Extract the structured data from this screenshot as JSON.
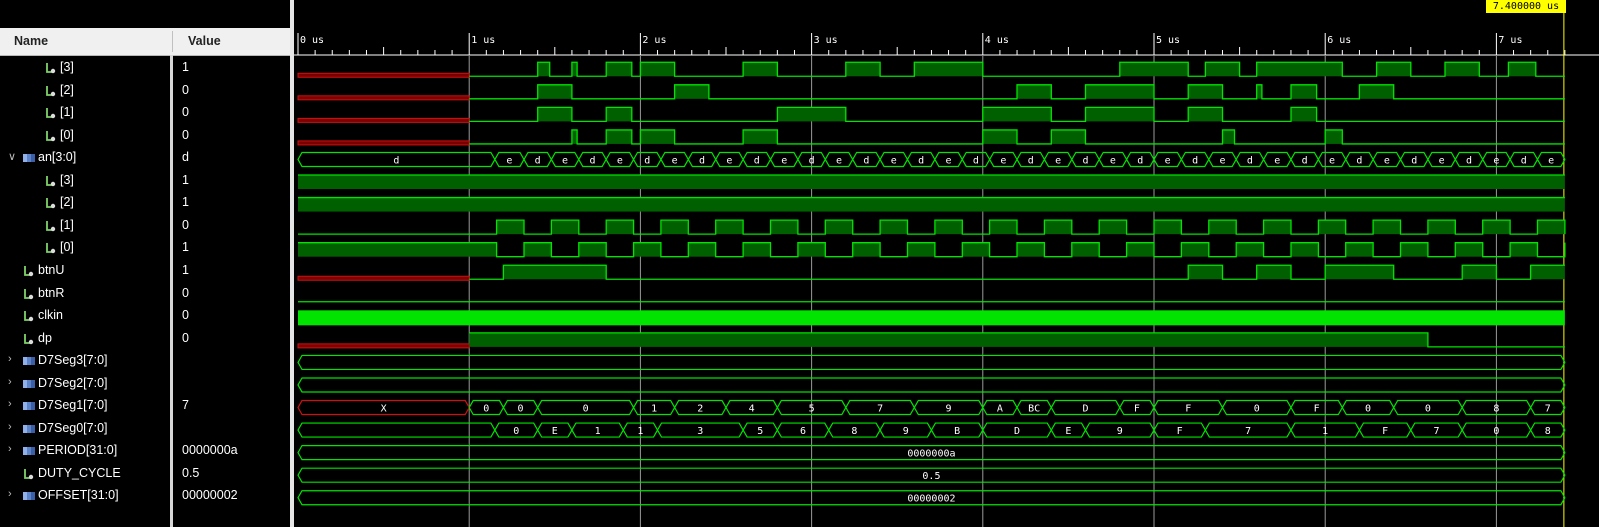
{
  "header": {
    "name_col": "Name",
    "value_col": "Value"
  },
  "cursor_time": "7.400000 us",
  "time_axis": {
    "unit": "us",
    "labels": [
      "0 us",
      "1 us",
      "2 us",
      "3 us",
      "4 us",
      "5 us",
      "6 us",
      "7 us"
    ],
    "range_us": [
      0,
      7.4
    ]
  },
  "colors": {
    "wave": "#00e400",
    "wave_fill": "#006000",
    "undefined": "#d01010",
    "grid": "#ffffff",
    "cursor_label_bg": "#ffff00"
  },
  "signals": [
    {
      "name": "[3]",
      "value": "1",
      "kind": "bit",
      "indent": 2
    },
    {
      "name": "[2]",
      "value": "0",
      "kind": "bit",
      "indent": 2
    },
    {
      "name": "[1]",
      "value": "0",
      "kind": "bit",
      "indent": 2
    },
    {
      "name": "[0]",
      "value": "0",
      "kind": "bit",
      "indent": 2
    },
    {
      "name": "an[3:0]",
      "value": "d",
      "kind": "bus",
      "indent": 0,
      "expanded": true
    },
    {
      "name": "[3]",
      "value": "1",
      "kind": "bit",
      "indent": 2
    },
    {
      "name": "[2]",
      "value": "1",
      "kind": "bit",
      "indent": 2
    },
    {
      "name": "[1]",
      "value": "0",
      "kind": "bit",
      "indent": 2
    },
    {
      "name": "[0]",
      "value": "1",
      "kind": "bit",
      "indent": 2
    },
    {
      "name": "btnU",
      "value": "1",
      "kind": "bit",
      "indent": 1
    },
    {
      "name": "btnR",
      "value": "0",
      "kind": "bit",
      "indent": 1
    },
    {
      "name": "clkin",
      "value": "0",
      "kind": "bit",
      "indent": 1
    },
    {
      "name": "dp",
      "value": "0",
      "kind": "bit",
      "indent": 1
    },
    {
      "name": "D7Seg3[7:0]",
      "value": "",
      "kind": "bus",
      "indent": 0,
      "expanded": false
    },
    {
      "name": "D7Seg2[7:0]",
      "value": "",
      "kind": "bus",
      "indent": 0,
      "expanded": false
    },
    {
      "name": "D7Seg1[7:0]",
      "value": "7",
      "kind": "bus",
      "indent": 0,
      "expanded": false
    },
    {
      "name": "D7Seg0[7:0]",
      "value": "",
      "kind": "bus",
      "indent": 0,
      "expanded": false
    },
    {
      "name": "PERIOD[31:0]",
      "value": "0000000a",
      "kind": "bus",
      "indent": 0,
      "expanded": false
    },
    {
      "name": "DUTY_CYCLE",
      "value": "0.5",
      "kind": "bit",
      "indent": 1
    },
    {
      "name": "OFFSET[31:0]",
      "value": "00000002",
      "kind": "bus",
      "indent": 0,
      "expanded": false
    }
  ],
  "waves": [
    {
      "type": "bit",
      "undef_until": 1.0,
      "init": 0,
      "edges": [
        1.4,
        1.47,
        1.6,
        1.63,
        1.8,
        1.95,
        2.0,
        2.2,
        2.6,
        2.8,
        3.2,
        3.4,
        3.6,
        4.0,
        4.8,
        5.2,
        5.3,
        5.5,
        5.6,
        6.1,
        6.3,
        6.5,
        6.7,
        6.9,
        7.07,
        7.23
      ]
    },
    {
      "type": "bit",
      "undef_until": 1.0,
      "init": 0,
      "edges": [
        1.4,
        1.6,
        2.2,
        2.4,
        4.2,
        4.4,
        4.6,
        5.0,
        5.2,
        5.4,
        5.6,
        5.63,
        5.8,
        5.95,
        6.2,
        6.4
      ]
    },
    {
      "type": "bit",
      "undef_until": 1.0,
      "init": 0,
      "edges": [
        1.4,
        1.6,
        1.8,
        1.95,
        2.8,
        3.2,
        4.0,
        4.4,
        4.6,
        5.0,
        5.2,
        5.4,
        5.8,
        5.95
      ]
    },
    {
      "type": "bit",
      "undef_until": 1.0,
      "init": 0,
      "edges": [
        1.6,
        1.63,
        1.8,
        1.95,
        2.0,
        2.2,
        2.6,
        2.8,
        4.0,
        4.2,
        4.4,
        4.6,
        5.4,
        5.47,
        6.0,
        6.1
      ]
    },
    {
      "type": "bus",
      "values": [
        "d",
        "e",
        "d",
        "e",
        "d",
        "e",
        "d",
        "e",
        "d",
        "e",
        "d",
        "e",
        "d",
        "e",
        "d",
        "e",
        "d",
        "e",
        "d",
        "e",
        "d",
        "e",
        "d",
        "e",
        "d",
        "e",
        "d",
        "e",
        "d",
        "e",
        "d",
        "e",
        "d",
        "e",
        "d",
        "e",
        "d",
        "e",
        "d",
        "e",
        "d",
        "e",
        "d",
        "e",
        "d",
        "e",
        "d",
        "e",
        "d",
        "e"
      ],
      "edges": [
        0,
        1.15,
        1.32,
        1.48,
        1.64,
        1.8,
        1.96,
        2.12,
        2.28,
        2.44,
        2.6,
        2.76,
        2.92,
        3.08,
        3.24,
        3.4,
        3.56,
        3.72,
        3.88,
        4.04,
        4.2,
        4.36,
        4.52,
        4.68,
        4.84,
        5.0,
        5.16,
        5.32,
        5.48,
        5.64,
        5.8,
        5.96,
        6.12,
        6.28,
        6.44,
        6.6,
        6.76,
        6.92,
        7.08,
        7.24,
        7.4
      ]
    },
    {
      "type": "bit",
      "undef_until": 0,
      "init": 1,
      "edges": []
    },
    {
      "type": "bit",
      "undef_until": 0,
      "init": 1,
      "edges": []
    },
    {
      "type": "bit",
      "undef_until": 0,
      "init": 0,
      "edges": [
        1.16,
        1.32,
        1.48,
        1.64,
        1.8,
        1.96,
        2.12,
        2.28,
        2.44,
        2.6,
        2.76,
        2.92,
        3.08,
        3.24,
        3.4,
        3.56,
        3.72,
        3.88,
        4.04,
        4.2,
        4.36,
        4.52,
        4.68,
        4.84,
        5.0,
        5.16,
        5.32,
        5.48,
        5.64,
        5.8,
        5.96,
        6.12,
        6.28,
        6.44,
        6.6,
        6.76,
        6.92,
        7.08,
        7.24,
        7.4
      ]
    },
    {
      "type": "bit",
      "undef_until": 0,
      "init": 1,
      "edges": [
        1.16,
        1.32,
        1.48,
        1.64,
        1.8,
        1.96,
        2.12,
        2.28,
        2.44,
        2.6,
        2.76,
        2.92,
        3.08,
        3.24,
        3.4,
        3.56,
        3.72,
        3.88,
        4.04,
        4.2,
        4.36,
        4.52,
        4.68,
        4.84,
        5.0,
        5.16,
        5.32,
        5.48,
        5.64,
        5.8,
        5.96,
        6.12,
        6.28,
        6.44,
        6.6,
        6.76,
        6.92,
        7.08,
        7.24,
        7.4
      ]
    },
    {
      "type": "bit",
      "undef_until": 1.0,
      "init": 0,
      "edges": [
        1.2,
        1.8,
        5.2,
        5.4,
        5.6,
        5.8,
        6.0,
        6.4,
        6.8,
        7.0,
        7.2
      ]
    },
    {
      "type": "bit",
      "undef_until": 0,
      "init": 0,
      "edges": []
    },
    {
      "type": "clock",
      "undef_until": 0,
      "init": 0,
      "edges": []
    },
    {
      "type": "bit",
      "undef_until": 1.0,
      "init": 1,
      "edges": [
        6.6
      ]
    },
    {
      "type": "bus",
      "values": [
        ""
      ],
      "edges": [
        0,
        7.4
      ]
    },
    {
      "type": "bus",
      "values": [
        ""
      ],
      "edges": [
        0,
        7.4
      ]
    },
    {
      "type": "bus",
      "undef_label": "X",
      "values": [
        "X",
        "0",
        "0",
        "0",
        "1",
        "2",
        "4",
        "5",
        "7",
        "9",
        "A",
        "BC",
        "D",
        "F",
        "F",
        "0",
        "F",
        "0",
        "0",
        "8",
        "7"
      ],
      "edges": [
        0,
        1.0,
        1.2,
        1.4,
        1.96,
        2.2,
        2.5,
        2.8,
        3.2,
        3.6,
        4.0,
        4.2,
        4.4,
        4.8,
        5.0,
        5.4,
        5.8,
        6.1,
        6.4,
        6.8,
        7.2,
        7.4
      ]
    },
    {
      "type": "bus",
      "values": [
        "",
        "0",
        "E",
        "1",
        "1",
        "3",
        "5",
        "6",
        "8",
        "9",
        "B",
        "D",
        "E",
        "9",
        "F",
        "7",
        "1",
        "F",
        "7",
        "0",
        "8"
      ],
      "edges": [
        0,
        1.15,
        1.4,
        1.6,
        1.9,
        2.1,
        2.6,
        2.8,
        3.1,
        3.4,
        3.7,
        4.0,
        4.4,
        4.6,
        5.0,
        5.3,
        5.8,
        6.2,
        6.5,
        6.8,
        7.2,
        7.4
      ]
    },
    {
      "type": "bus",
      "values": [
        "0000000a"
      ],
      "edges": [
        0,
        7.4
      ]
    },
    {
      "type": "bus",
      "values": [
        "0.5"
      ],
      "edges": [
        0,
        7.4
      ]
    },
    {
      "type": "bus",
      "values": [
        "00000002"
      ],
      "edges": [
        0,
        7.4
      ]
    }
  ]
}
